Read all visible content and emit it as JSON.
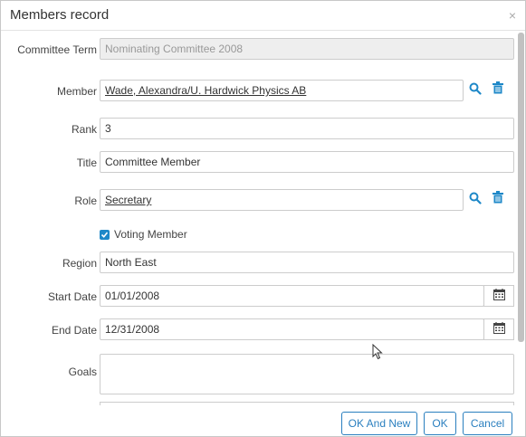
{
  "dialog": {
    "title": "Members record",
    "close_glyph": "×"
  },
  "fields": {
    "committee_term": {
      "label": "Committee Term",
      "value": "Nominating Committee 2008"
    },
    "member": {
      "label": "Member",
      "value": "Wade, Alexandra/U. Hardwick Physics AB"
    },
    "rank": {
      "label": "Rank",
      "value": "3"
    },
    "title": {
      "label": "Title",
      "value": "Committee Member"
    },
    "role": {
      "label": "Role",
      "value": "Secretary"
    },
    "voting_member": {
      "label": "Voting Member",
      "checked": true
    },
    "region": {
      "label": "Region",
      "value": "North East"
    },
    "start_date": {
      "label": "Start Date",
      "value": "01/01/2008"
    },
    "end_date": {
      "label": "End Date",
      "value": "12/31/2008"
    },
    "goals": {
      "label": "Goals",
      "value": ""
    }
  },
  "buttons": {
    "ok_and_new": "OK And New",
    "ok": "OK",
    "cancel": "Cancel"
  },
  "colors": {
    "accent": "#1e88c8",
    "button_border": "#2a7fbf",
    "readonly_bg": "#eeeeee"
  }
}
